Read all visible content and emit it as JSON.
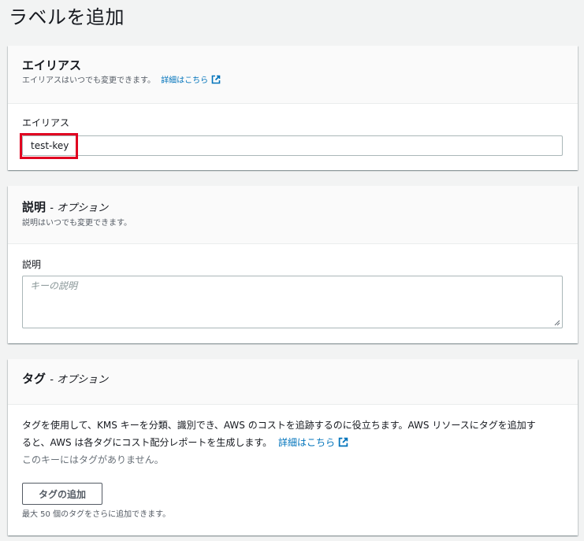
{
  "page": {
    "title": "ラベルを追加"
  },
  "alias_panel": {
    "title": "エイリアス",
    "description": "エイリアスはいつでも変更できます。",
    "learn_more": "詳細はこちら",
    "field_label": "エイリアス",
    "value": "test-key"
  },
  "description_panel": {
    "title": "説明",
    "optional": "- オプション",
    "description": "説明はいつでも変更できます。",
    "field_label": "説明",
    "placeholder": "キーの説明"
  },
  "tags_panel": {
    "title": "タグ",
    "optional": "- オプション",
    "body_line1": "タグを使用して、KMS キーを分類、識別でき、AWS のコストを追跡するのに役立ちます。AWS リソースにタグを追加す",
    "body_line2": "ると、AWS は各タグにコスト配分レポートを生成します。",
    "learn_more": "詳細はこちら",
    "empty_text": "このキーにはタグがありません。",
    "add_button": "タグの追加",
    "limit_text": "最大 50 個のタグをさらに追加できます。"
  },
  "colors": {
    "link": "#0073bb",
    "highlight": "#e00020",
    "background": "#f2f3f3"
  }
}
